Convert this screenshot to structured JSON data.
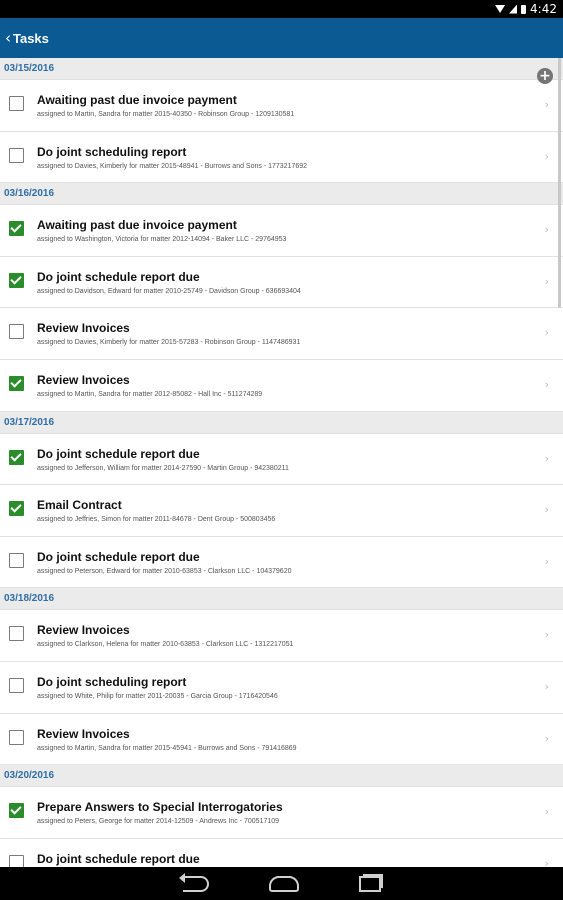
{
  "status_bar": {
    "time": "4:42"
  },
  "app_bar": {
    "back_label": "Tasks"
  },
  "groups": [
    {
      "date": "03/15/2016",
      "tasks": [
        {
          "title": "Awaiting past due invoice payment",
          "subtitle": "assigned to Martin, Sandra for matter 2015-40350 - Robinson Group - 1209130581",
          "checked": false
        },
        {
          "title": "Do joint scheduling report",
          "subtitle": "assigned to Davies, Kimberly for matter 2015-48941 - Burrows and Sons - 1773217692",
          "checked": false
        }
      ]
    },
    {
      "date": "03/16/2016",
      "tasks": [
        {
          "title": "Awaiting past due invoice payment",
          "subtitle": "assigned to Washington, Victoria for matter 2012-14094 - Baker LLC - 29764953",
          "checked": true
        },
        {
          "title": "Do joint schedule report due",
          "subtitle": "assigned to Davidson, Edward for matter 2010-25749 - Davidson Group - 636693404",
          "checked": true
        },
        {
          "title": "Review Invoices",
          "subtitle": "assigned to Davies, Kimberly for matter 2015-57283 - Robinson Group - 1147486931",
          "checked": false
        },
        {
          "title": "Review Invoices",
          "subtitle": "assigned to Martin, Sandra for matter 2012-85082 - Hall Inc - 511274289",
          "checked": true
        }
      ]
    },
    {
      "date": "03/17/2016",
      "tasks": [
        {
          "title": "Do joint schedule report due",
          "subtitle": "assigned to Jefferson, William for matter 2014-27590 - Martin Group - 942380211",
          "checked": true
        },
        {
          "title": "Email Contract",
          "subtitle": "assigned to Jeffries, Simon for matter 2011-84678 - Dent Group - 500803456",
          "checked": true
        },
        {
          "title": "Do joint schedule report due",
          "subtitle": "assigned to Peterson, Edward for matter 2010-63853 - Clarkson LLC - 104379620",
          "checked": false
        }
      ]
    },
    {
      "date": "03/18/2016",
      "tasks": [
        {
          "title": "Review Invoices",
          "subtitle": "assigned to Clarkson, Helena for matter 2010-63853 - Clarkson LLC - 1312217051",
          "checked": false
        },
        {
          "title": "Do joint scheduling report",
          "subtitle": "assigned to White, Philip for matter 2011-20035 - Garcia Group - 1716420546",
          "checked": false
        },
        {
          "title": "Review Invoices",
          "subtitle": "assigned to Martin, Sandra for matter 2015-45941 - Burrows and Sons - 791416869",
          "checked": false
        }
      ]
    },
    {
      "date": "03/20/2016",
      "tasks": [
        {
          "title": "Prepare Answers to Special Interrogatories",
          "subtitle": "assigned to Peters, George for matter 2014-12509 - Andrews Inc - 700517109",
          "checked": true
        },
        {
          "title": "Do joint schedule report due",
          "subtitle": "",
          "checked": false
        }
      ]
    }
  ],
  "icons": {
    "add": "add-circle-icon",
    "row_arrow": "chevron-right-icon"
  },
  "colors": {
    "app_bar": "#0b5a94",
    "date_text": "#2f6ea5",
    "checked": "#2a8c2a"
  }
}
